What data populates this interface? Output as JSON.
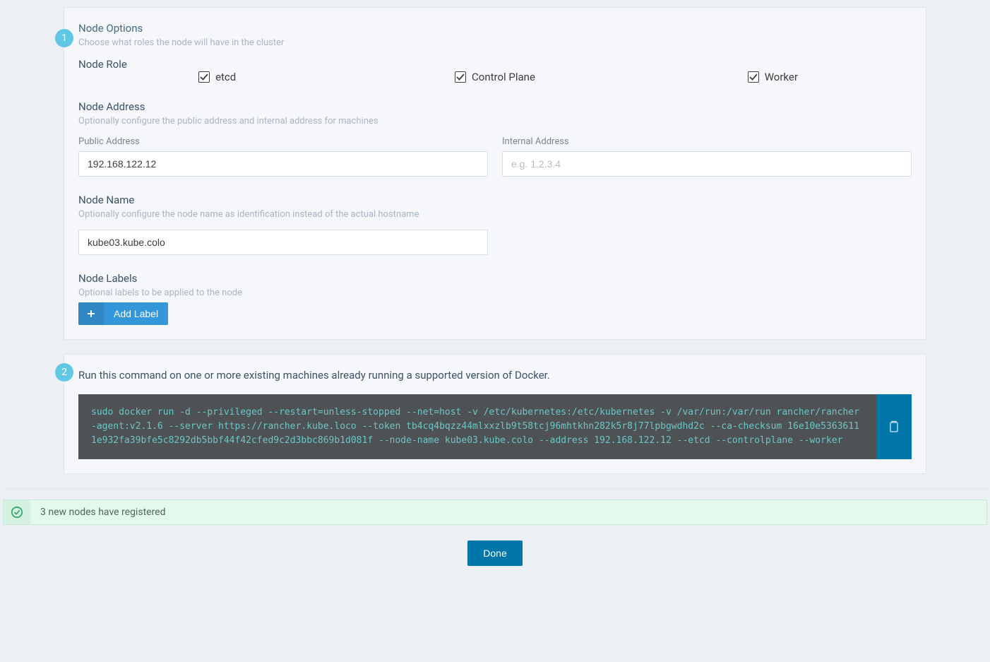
{
  "step1": {
    "badge": "1",
    "title": "Node Options",
    "subtitle": "Choose what roles the node will have in the cluster",
    "role": {
      "heading": "Node Role",
      "options": {
        "etcd": "etcd",
        "controlplane": "Control Plane",
        "worker": "Worker"
      }
    },
    "address": {
      "heading": "Node Address",
      "subtitle": "Optionally configure the public address and internal address for machines",
      "public_label": "Public Address",
      "public_value": "192.168.122.12",
      "internal_label": "Internal Address",
      "internal_placeholder": "e.g. 1.2.3.4"
    },
    "name": {
      "heading": "Node Name",
      "subtitle": "Optionally configure the node name as identification instead of the actual hostname",
      "value": "kube03.kube.colo"
    },
    "labels": {
      "heading": "Node Labels",
      "subtitle": "Optional labels to be applied to the node",
      "add_button": "Add Label"
    }
  },
  "step2": {
    "badge": "2",
    "instruction": "Run this command on one or more existing machines already running a supported version of Docker.",
    "command": "sudo docker run -d --privileged --restart=unless-stopped --net=host -v /etc/kubernetes:/etc/kubernetes -v /var/run:/var/run rancher/rancher-agent:v2.1.6 --server https://rancher.kube.loco --token tb4cq4bqzz44mlxxzlb9t58tcj96mhtkhn282k5r8j77lpbgwdhd2c --ca-checksum 16e10e53636111e932fa39bfe5c8292db5bbf44f42cfed9c2d3bbc869b1d081f --node-name kube03.kube.colo --address 192.168.122.12 --etcd --controlplane --worker"
  },
  "banner": {
    "message": "3 new nodes have registered"
  },
  "done_label": "Done"
}
